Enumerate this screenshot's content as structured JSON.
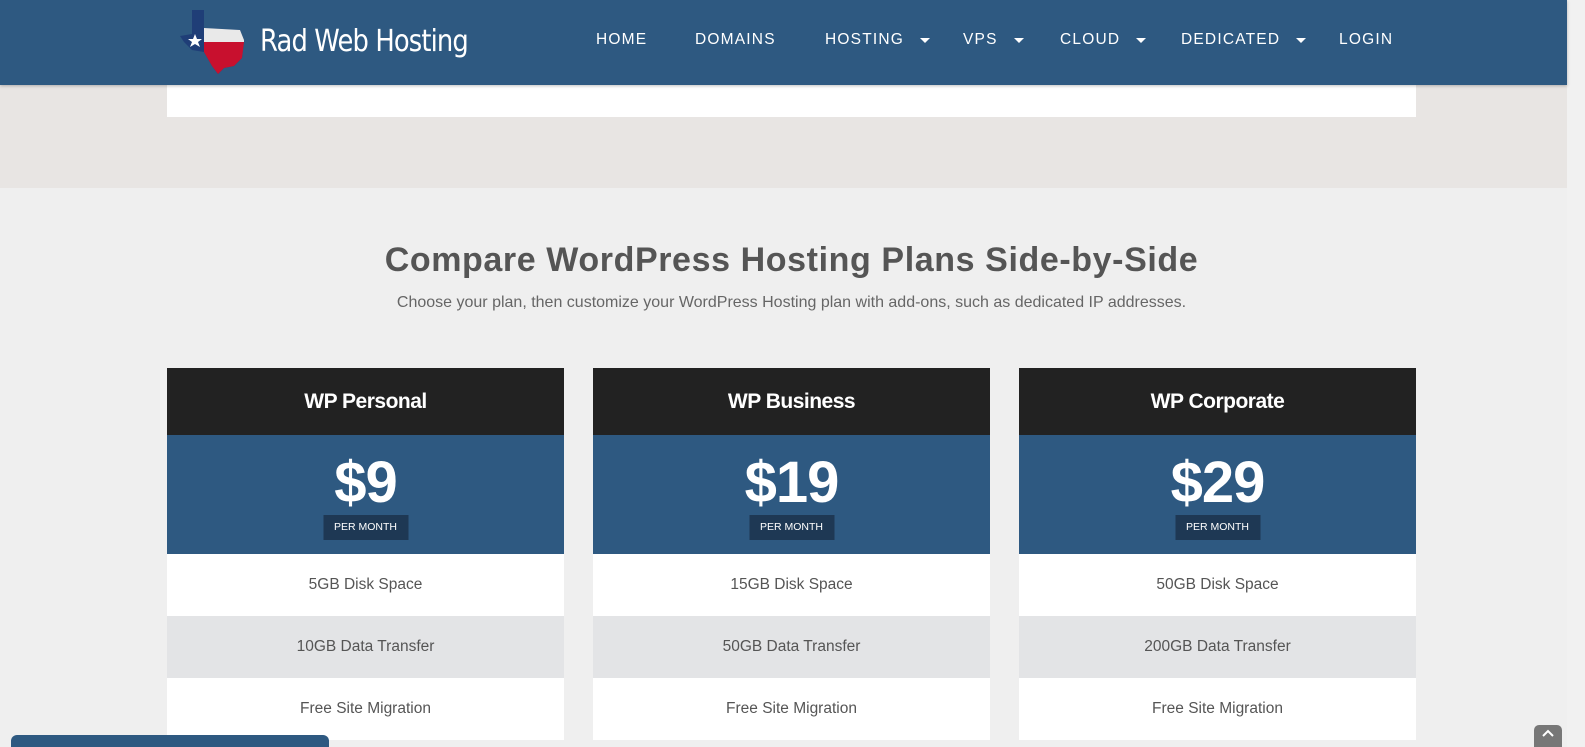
{
  "brand": {
    "name": "Rad Web Hosting",
    "colors": {
      "primary": "#2e5981",
      "dark": "#222222",
      "flag_red": "#c8102e"
    }
  },
  "nav": {
    "items": [
      {
        "label": "HOME",
        "dropdown": false
      },
      {
        "label": "DOMAINS",
        "dropdown": false
      },
      {
        "label": "HOSTING",
        "dropdown": true
      },
      {
        "label": "VPS",
        "dropdown": true
      },
      {
        "label": "CLOUD",
        "dropdown": true
      },
      {
        "label": "DEDICATED",
        "dropdown": true
      },
      {
        "label": "LOGIN",
        "dropdown": false
      }
    ]
  },
  "section": {
    "title": "Compare WordPress Hosting Plans Side-by-Side",
    "subtitle": "Choose your plan, then customize your WordPress Hosting plan with add-ons, such as dedicated IP addresses."
  },
  "plans": [
    {
      "name": "WP Personal",
      "price": "$9",
      "period": "PER MONTH",
      "features": [
        "5GB Disk Space",
        "10GB Data Transfer",
        "Free Site Migration"
      ]
    },
    {
      "name": "WP Business",
      "price": "$19",
      "period": "PER MONTH",
      "features": [
        "15GB Disk Space",
        "50GB Data Transfer",
        "Free Site Migration"
      ]
    },
    {
      "name": "WP Corporate",
      "price": "$29",
      "period": "PER MONTH",
      "features": [
        "50GB Disk Space",
        "200GB Data Transfer",
        "Free Site Migration"
      ]
    }
  ],
  "icons": {
    "logo": "texas-flag-icon",
    "nav_dropdown": "caret-down-icon",
    "scroll_top": "chevron-up-icon"
  }
}
